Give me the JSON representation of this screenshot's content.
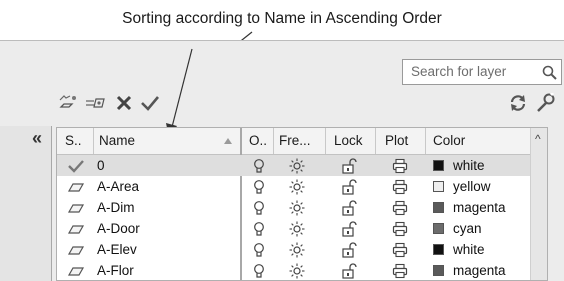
{
  "annotation": {
    "text": "Sorting according to Name in Ascending Order"
  },
  "search": {
    "placeholder": "Search for layer",
    "icon": "search-icon"
  },
  "toolbar": {
    "left_icons": [
      "new-layer-icon",
      "new-layer-vp-frozen-icon",
      "delete-layer-icon",
      "set-current-icon"
    ],
    "right_icons": [
      "refresh-icon",
      "settings-icon"
    ]
  },
  "collapse_label": "«",
  "table": {
    "columns": [
      "S..",
      "Name",
      "O..",
      "Fre...",
      "Lock",
      "Plot",
      "Color"
    ],
    "sort": {
      "column": "Name",
      "order": "ascending"
    },
    "rows": [
      {
        "status": "current",
        "name": "0",
        "color": "white",
        "swatch": "#111111",
        "selected": true
      },
      {
        "status": "layer",
        "name": "A-Area",
        "color": "yellow",
        "swatch": "#efefef",
        "selected": false
      },
      {
        "status": "layer",
        "name": "A-Dim",
        "color": "magenta",
        "swatch": "#5a5a5a",
        "selected": false
      },
      {
        "status": "layer",
        "name": "A-Door",
        "color": "cyan",
        "swatch": "#6c6c6c",
        "selected": false
      },
      {
        "status": "layer",
        "name": "A-Elev",
        "color": "white",
        "swatch": "#111111",
        "selected": false
      },
      {
        "status": "layer",
        "name": "A-Flor",
        "color": "magenta",
        "swatch": "#5a5a5a",
        "selected": false
      }
    ]
  }
}
